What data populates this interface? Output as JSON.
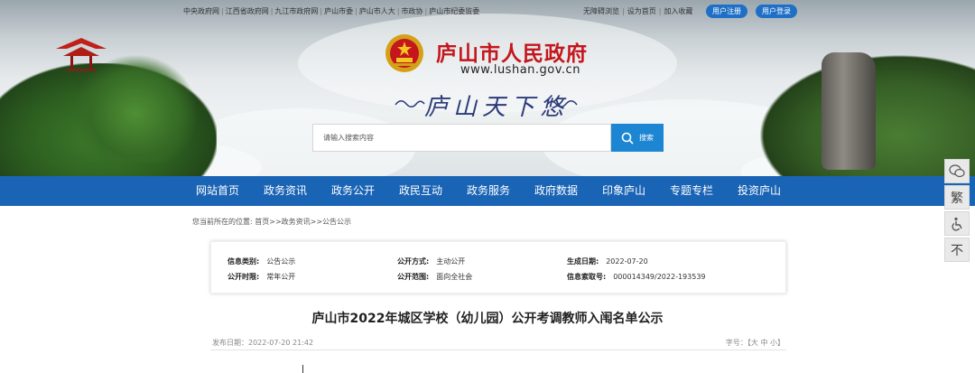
{
  "top_links": [
    "中央政府网",
    "江西省政府网",
    "九江市政府网",
    "庐山市委",
    "庐山市人大",
    "市政协",
    "庐山市纪委监委"
  ],
  "right_links": [
    "无障碍浏览",
    "设为首页",
    "加入收藏"
  ],
  "buttons": {
    "register": "用户注册",
    "login": "用户登录"
  },
  "header": {
    "title": "庐山市人民政府",
    "url": "www.lushan.gov.cn",
    "slogan": "庐山天下悠"
  },
  "search": {
    "placeholder": "请输入搜索内容",
    "button_label": "搜索"
  },
  "nav": [
    "网站首页",
    "政务资讯",
    "政务公开",
    "政民互动",
    "政务服务",
    "政府数据",
    "印象庐山",
    "专题专栏",
    "投资庐山"
  ],
  "side_buttons": {
    "traditional": "繁",
    "scroll_top": "不"
  },
  "breadcrumb": "您当前所在的位置: 首页>>政务资讯>>公告公示",
  "info": {
    "category_label": "信息类别:",
    "category": "公告公示",
    "open_method_label": "公开方式:",
    "open_method": "主动公开",
    "date_label": "生成日期:",
    "date": "2022-07-20",
    "period_label": "公开时限:",
    "period": "常年公开",
    "scope_label": "公开范围:",
    "scope": "面向全社会",
    "index_label": "信息索取号:",
    "index": "000014349/2022-193539"
  },
  "article": {
    "title": "庐山市2022年城区学校（幼儿园）公开考调教师入闱名单公示",
    "publish_label": "发布日期：",
    "publish_time": "2022-07-20 21:42",
    "font_size_label": "字号：【大 中 小】"
  },
  "colors": {
    "nav_bg": "#1a64b5",
    "title_red": "#c4161c",
    "search_btn": "#1d86d3",
    "pill_btn": "#1f6fc6"
  },
  "icons": {
    "search": "search-icon",
    "wechat": "wechat-icon",
    "accessibility": "wheelchair-icon",
    "emblem": "national-emblem-icon"
  }
}
